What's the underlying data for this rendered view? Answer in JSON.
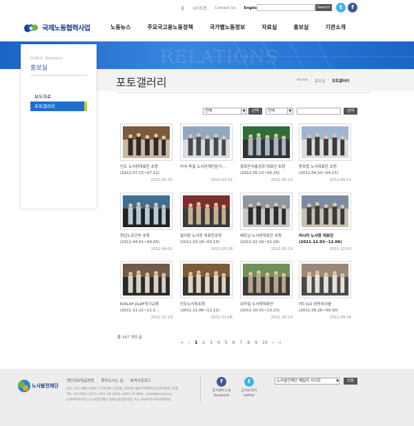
{
  "util": {
    "links": [
      "홈",
      "사이트맵",
      "Contact Us",
      "English"
    ],
    "search_button": "Search",
    "twitter_glyph": "t",
    "facebook_glyph": "f"
  },
  "brand": {
    "name": "국제노동협력사업",
    "accent": "#1e6fcf",
    "leaf": "#1a3d8f",
    "green": "#6cb33f"
  },
  "nav": [
    "노동뉴스",
    "주요국고용노동정책",
    "국가별노동정보",
    "자료실",
    "홍보실",
    "기관소개"
  ],
  "banner": {
    "watermark": "RELATIONS"
  },
  "sidebar": {
    "subtitle": "PUBLIC Relations",
    "title": "홍보실",
    "items": [
      "보도자료",
      "포토갤러리"
    ],
    "active_index": 1
  },
  "page": {
    "title": "포토갤러리",
    "breadcrumb": [
      "Home",
      "홍보실",
      "포토갤러리"
    ]
  },
  "filters": {
    "select1": "전체",
    "select_button": "선택",
    "select2": "전체",
    "search_button": "검색"
  },
  "gallery": [
    {
      "caption": "인도 노사장대표단 초청 (2012.07.15~07.21)",
      "date": "2012-07-15",
      "bold": false
    },
    {
      "caption": "미국-독일 노사관계전문가...",
      "date": "2012-07-02",
      "bold": false
    },
    {
      "caption": "중화전국총공회 대표단 초청(2012.05.13~05.20)",
      "date": "2012-05-13",
      "bold": false
    },
    {
      "caption": "동유럽 노사대표단 초청 (2012.04.23~04.27)",
      "date": "2012-04-21",
      "bold": false
    },
    {
      "caption": "청년노조간부 초청 (2012.04.01~04.05)",
      "date": "2012-04-01",
      "bold": false
    },
    {
      "caption": "필리핀 노사정 대표단초청 (2012.03.18~03.23)",
      "date": "2012-03-18",
      "bold": false
    },
    {
      "caption": "베트남 노사정대표단 초청 (2012.02.19~02.24)",
      "date": "2012-02-19",
      "bold": false
    },
    {
      "caption": "러시아 노사정 대표단 (2011.12.03~12.06)",
      "date": "2011-12-03",
      "bold": true
    },
    {
      "caption": "KOILAF-JILAF정기교류 (2011.11.21~11.2...",
      "date": "2011-11-29",
      "bold": false
    },
    {
      "caption": "인도노사정초청 (2011.11.06~11.12)",
      "date": "2011-11-06",
      "bold": false
    },
    {
      "caption": "브라질 노사정대표단 (2011.10.15~10.21)",
      "date": "2011-10-14",
      "bold": false
    },
    {
      "caption": "ITC-ILO 공동워크숍 (2011.09.26~09.30)",
      "date": "2011-09-26",
      "bold": false
    }
  ],
  "total_text": "총 147 개의 글",
  "pagination": {
    "prev": [
      "«",
      "‹"
    ],
    "pages": [
      "1",
      "2",
      "3",
      "4",
      "5",
      "6",
      "7",
      "8",
      "9",
      "10"
    ],
    "current": "1",
    "next": [
      "›",
      "»"
    ]
  },
  "footer": {
    "logo_text": "노사발전재단",
    "links": [
      "개인정보취급방침",
      "찾아오시는 길",
      "뷰어다운로드"
    ],
    "address": "121-714 서울시 마포구 마포대로 (공덕동 358-8) 혈담부제대한공공관리빌딩 10층",
    "contact": "TEL. 02-6021-1077 | FAX. 02-6021-1493 | E-MAIL. koilaf@koilaf.org",
    "copyright": "COPYRIGHT(C) 노사발전재단 국제노동협력사업. ALL RIGHTS RESERVED.",
    "facebook_label": "공식페이스북",
    "facebook_sub": "facebook",
    "twitter_label": "공식트위터",
    "twitter_sub": "twitter",
    "family_site": "노사발전재단 패밀리 사이트",
    "go_button": "이동"
  }
}
